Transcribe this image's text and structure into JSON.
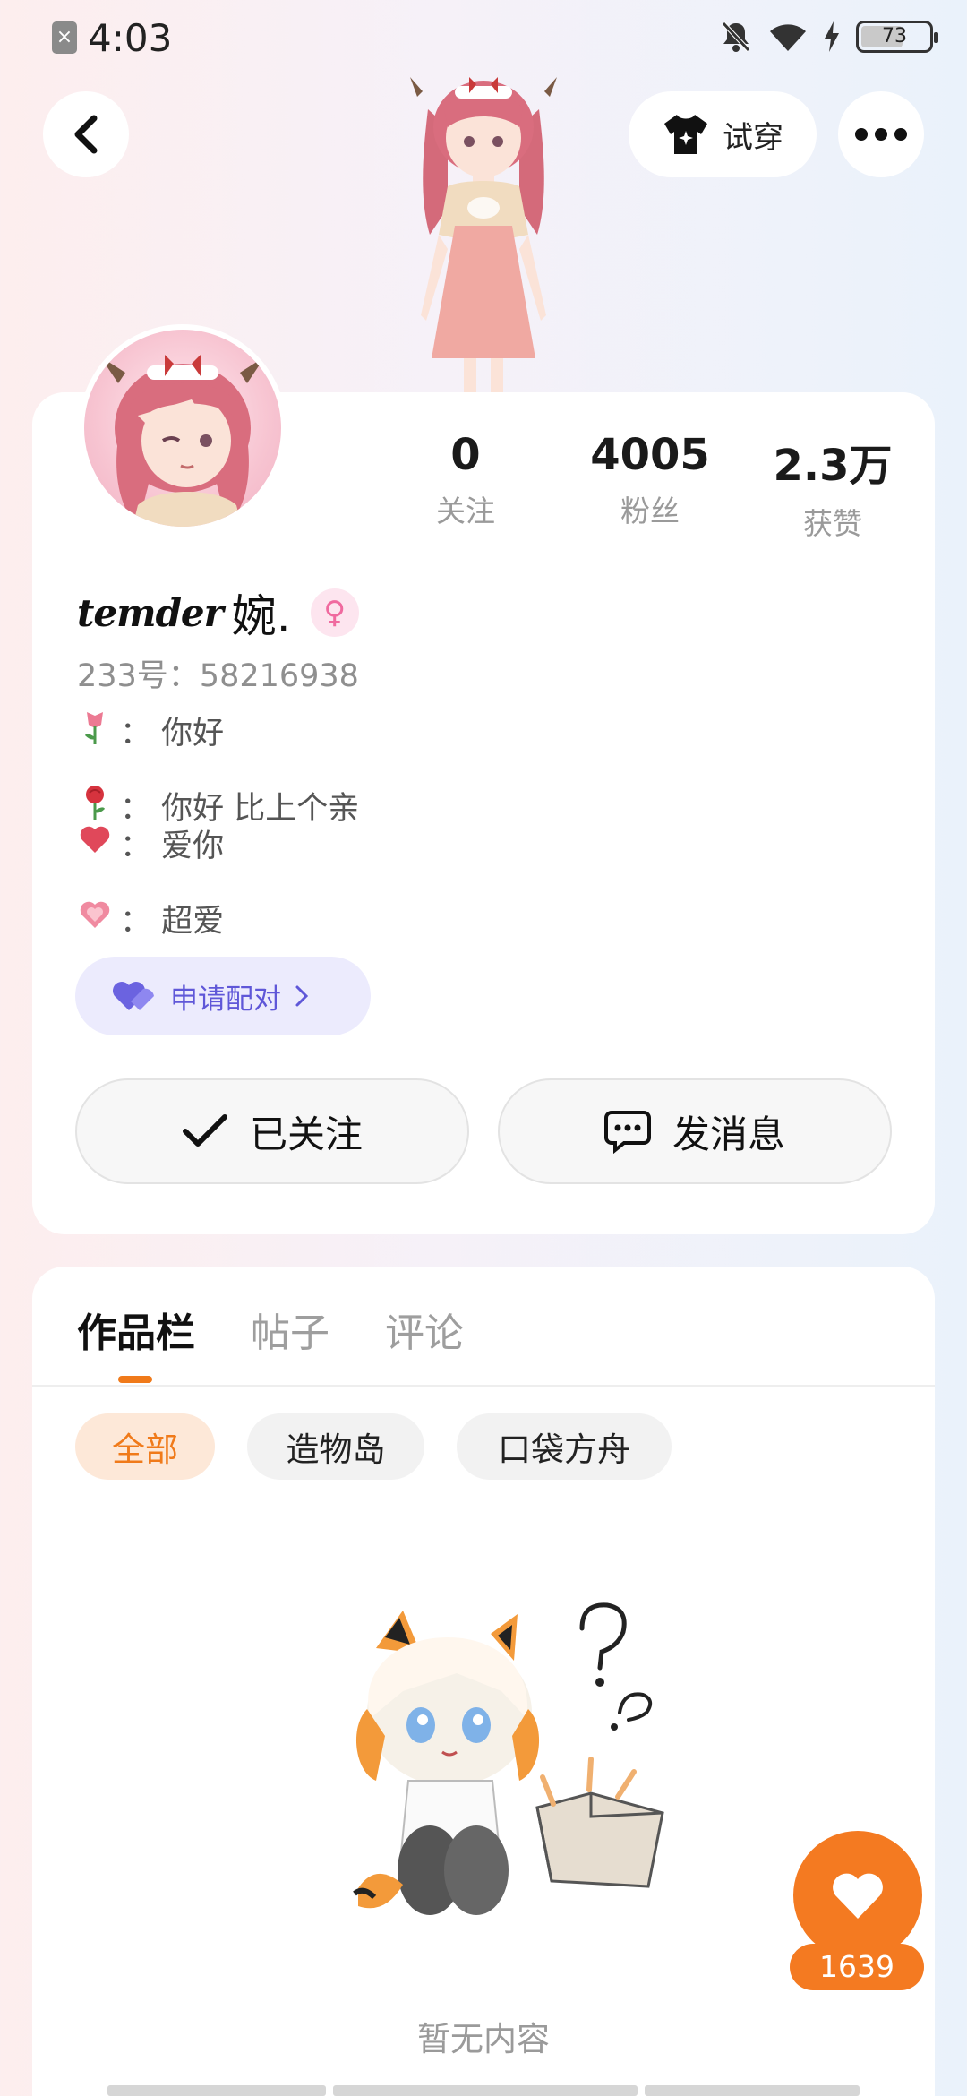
{
  "status_bar": {
    "time": "4:03",
    "battery": "73",
    "notif_badge": "×"
  },
  "header": {
    "tryon_label": "试穿"
  },
  "profile": {
    "stats": [
      {
        "value": "0",
        "label": "关注"
      },
      {
        "value": "4005",
        "label": "粉丝"
      },
      {
        "value": "2.3万",
        "label": "获赞"
      }
    ],
    "nickname_fancy": "temder",
    "nickname_rest": "婉.",
    "gender_symbol": "♀",
    "uid": "233号：58216938",
    "bio": [
      {
        "icon": "tulip-icon",
        "emoji": "🌷",
        "text": "：  你好"
      },
      {
        "icon": "rose-icon",
        "emoji": "🌹",
        "text": "：  你好 比上个亲"
      },
      {
        "icon": "red-heart-icon",
        "emoji": "❤",
        "text": "：  爱你"
      },
      {
        "icon": "pink-heart-icon",
        "emoji": "💗",
        "text": "：  超爱"
      }
    ],
    "pair_label": "申请配对",
    "follow_label": "已关注",
    "message_label": "发消息"
  },
  "works": {
    "tabs": [
      "作品栏",
      "帖子",
      "评论"
    ],
    "active_tab": 0,
    "filters": [
      "全部",
      "造物岛",
      "口袋方舟"
    ],
    "active_filter": 0,
    "empty_text": "暂无内容"
  },
  "like_fab": {
    "count": "1639"
  },
  "colors": {
    "accent": "#f47a21",
    "pair": "#5f57d8"
  }
}
